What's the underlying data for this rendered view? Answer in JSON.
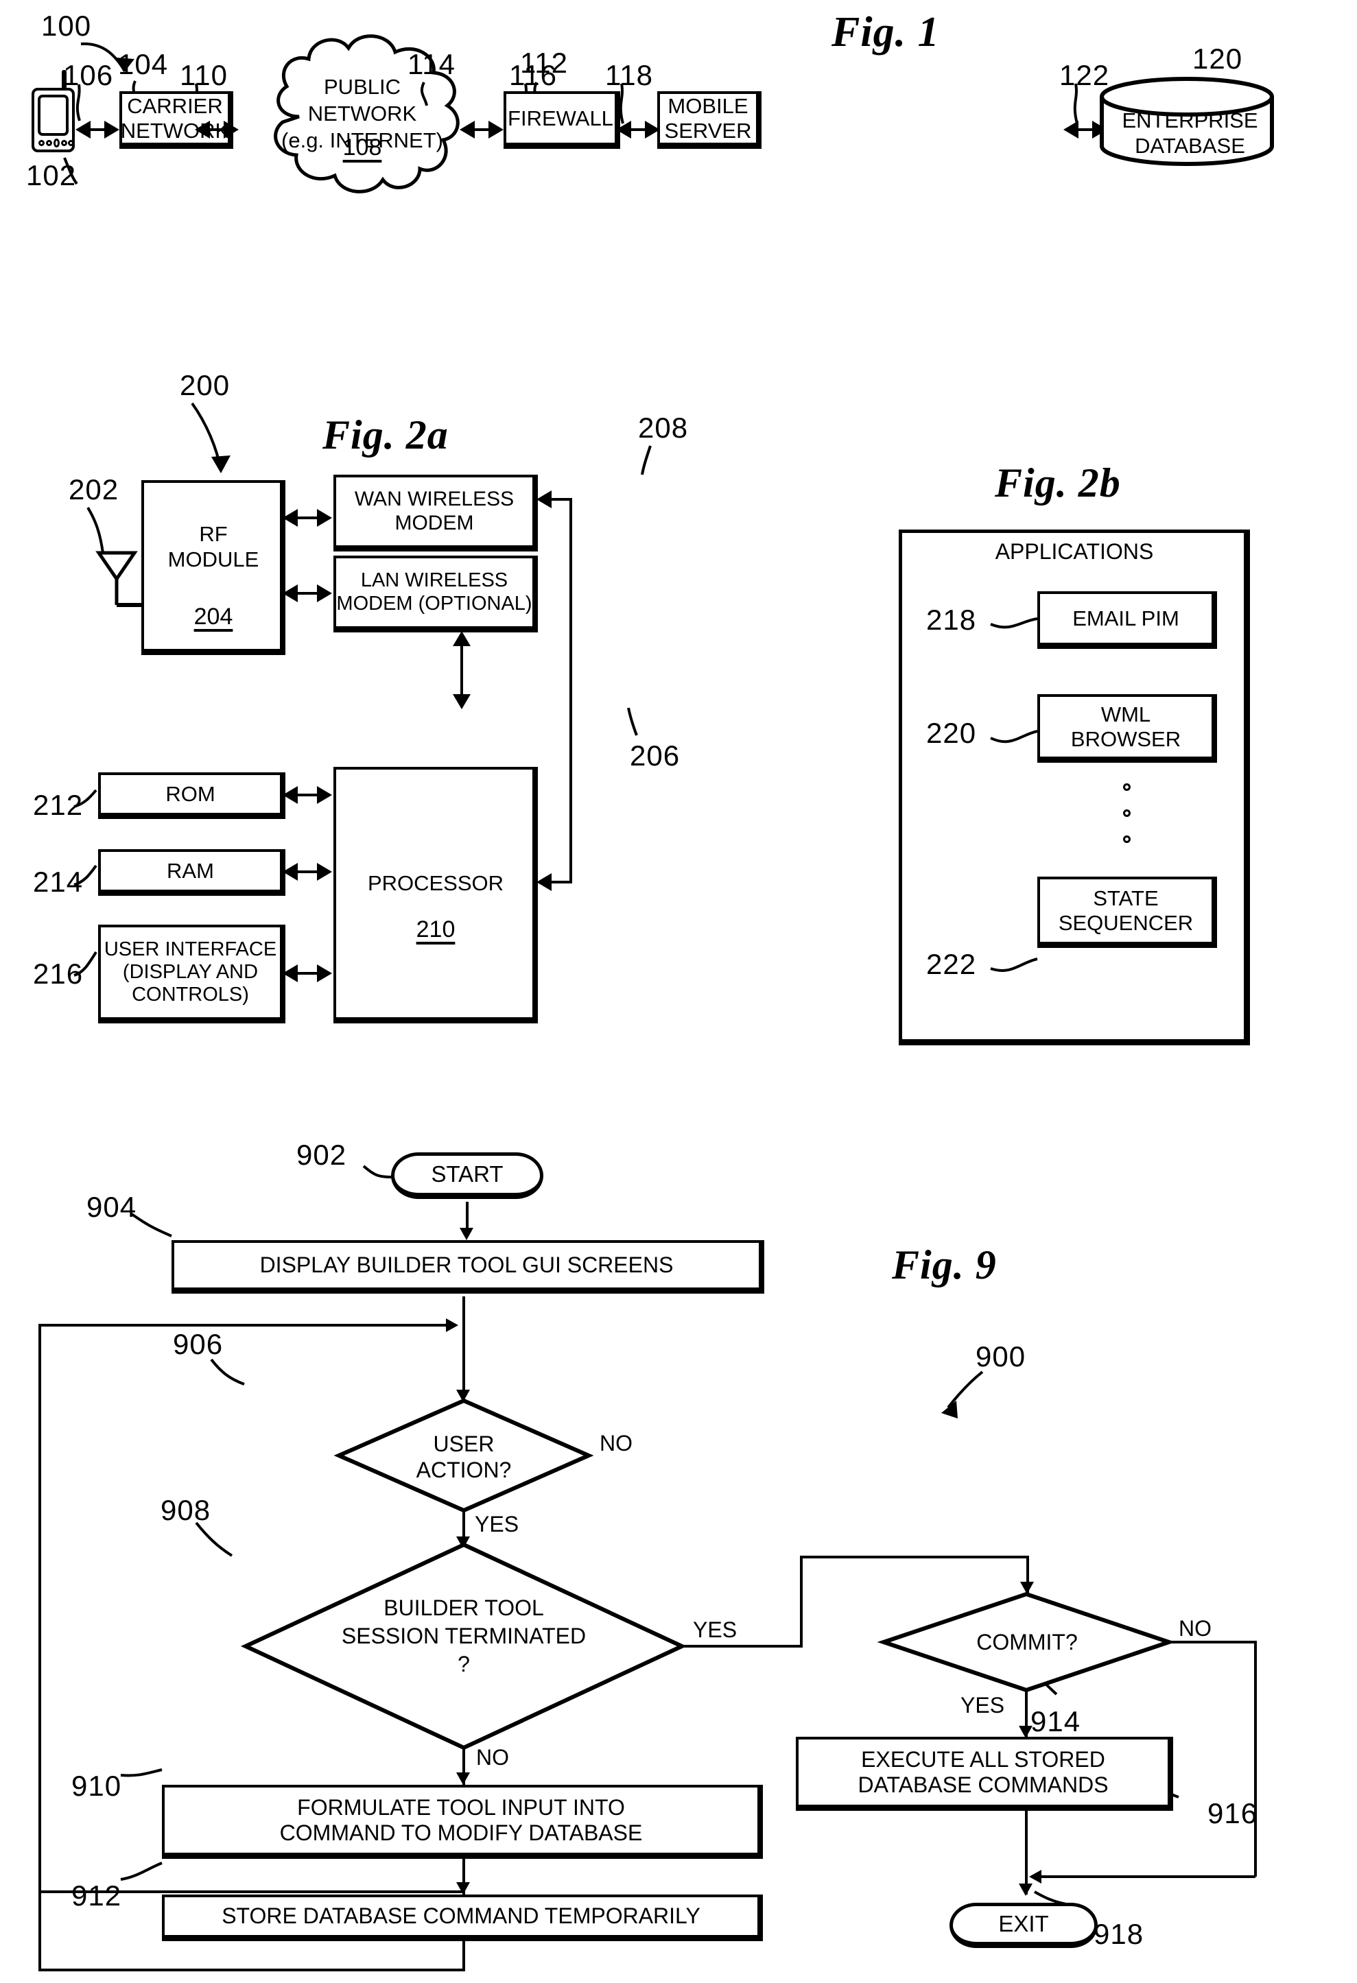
{
  "figures": [
    {
      "id": "fig1",
      "title": "Fig. 1",
      "system_ref": "100",
      "nodes": [
        {
          "ref": "102",
          "label": "mobile device"
        },
        {
          "ref": "104",
          "label": "CARRIER\nNETWORK"
        },
        {
          "ref": "108",
          "label": "PUBLIC\nNETWORK\n(e.g. INTERNET)"
        },
        {
          "ref": "114",
          "label": "FIREWALL"
        },
        {
          "ref": "112",
          "label": "MOBILE\nSERVER"
        },
        {
          "ref": "120",
          "label": "ENTERPRISE\nDATABASE"
        }
      ],
      "links": [
        "106",
        "110",
        "116",
        "118",
        "122"
      ]
    },
    {
      "id": "fig2a",
      "title": "Fig. 2a",
      "system_ref": "200",
      "nodes": [
        {
          "ref": "202",
          "label": "antenna"
        },
        {
          "ref": "204",
          "label": "RF\nMODULE"
        },
        {
          "ref": "208",
          "label": "WAN WIRELESS\nMODEM"
        },
        {
          "ref": "206",
          "label": "LAN WIRELESS\nMODEM (OPTIONAL)"
        },
        {
          "ref": "212",
          "label": "ROM"
        },
        {
          "ref": "214",
          "label": "RAM"
        },
        {
          "ref": "216",
          "label": "USER INTERFACE\n(DISPLAY AND\nCONTROLS)"
        },
        {
          "ref": "210",
          "label": "PROCESSOR"
        }
      ]
    },
    {
      "id": "fig2b",
      "title": "Fig. 2b",
      "container_label": "APPLICATIONS",
      "nodes": [
        {
          "ref": "218",
          "label": "EMAIL PIM"
        },
        {
          "ref": "220",
          "label": "WML\nBROWSER"
        },
        {
          "ref": "222",
          "label": "STATE\nSEQUENCER"
        }
      ],
      "ellipsis": "○ ○ ○"
    },
    {
      "id": "fig9",
      "title": "Fig. 9",
      "system_ref": "900",
      "nodes": [
        {
          "ref": "902",
          "label": "START",
          "shape": "terminator"
        },
        {
          "ref": "904",
          "label": "DISPLAY BUILDER TOOL GUI SCREENS",
          "shape": "process"
        },
        {
          "ref": "906",
          "label": "USER\nACTION?",
          "shape": "decision"
        },
        {
          "ref": "908",
          "label": "BUILDER TOOL\nSESSION TERMINATED\n?",
          "shape": "decision"
        },
        {
          "ref": "910",
          "label": "FORMULATE TOOL INPUT INTO\nCOMMAND TO MODIFY DATABASE",
          "shape": "process"
        },
        {
          "ref": "912",
          "label": "STORE DATABASE COMMAND TEMPORARILY",
          "shape": "process"
        },
        {
          "ref": "914",
          "label": "COMMIT?",
          "shape": "decision"
        },
        {
          "ref": "916",
          "label": "EXECUTE ALL STORED\nDATABASE COMMANDS",
          "shape": "process"
        },
        {
          "ref": "918",
          "label": "EXIT",
          "shape": "terminator"
        }
      ],
      "branch_labels": {
        "user_action_no": "NO",
        "user_action_yes": "YES",
        "session_yes": "YES",
        "session_no": "NO",
        "commit_no": "NO",
        "commit_yes": "YES"
      }
    }
  ],
  "fig1": {
    "title": "Fig. 1",
    "ref_system": "100",
    "ref_device": "102",
    "ref_link_device_carrier": "106",
    "ref_carrier": "104",
    "ref_link_carrier_net": "110",
    "ref_cloud": "108",
    "ref_link_net_firewall": "116",
    "ref_firewall": "114",
    "ref_link_firewall_server": "118",
    "ref_server": "112",
    "ref_link_server_db": "122",
    "ref_db": "120",
    "carrier_line1": "CARRIER",
    "carrier_line2": "NETWORK",
    "cloud_line1": "PUBLIC",
    "cloud_line2": "NETWORK",
    "cloud_line3": "(e.g. INTERNET)",
    "firewall_label": "FIREWALL",
    "server_line1": "MOBILE",
    "server_line2": "SERVER",
    "db_line1": "ENTERPRISE",
    "db_line2": "DATABASE"
  },
  "fig2a": {
    "title": "Fig. 2a",
    "ref_system": "200",
    "ref_antenna": "202",
    "ref_rf": "204",
    "ref_wan": "208",
    "ref_lan": "206",
    "ref_rom": "212",
    "ref_ram": "214",
    "ref_ui": "216",
    "ref_proc": "210",
    "rf_line1": "RF",
    "rf_line2": "MODULE",
    "wan_line1": "WAN WIRELESS",
    "wan_line2": "MODEM",
    "lan_line1": "LAN WIRELESS",
    "lan_line2": "MODEM (OPTIONAL)",
    "rom_label": "ROM",
    "ram_label": "RAM",
    "ui_line1": "USER INTERFACE",
    "ui_line2": "(DISPLAY AND",
    "ui_line3": "CONTROLS)",
    "proc_label": "PROCESSOR"
  },
  "fig2b": {
    "title": "Fig. 2b",
    "applications_label": "APPLICATIONS",
    "ref_email": "218",
    "ref_wml": "220",
    "ref_state": "222",
    "email_label": "EMAIL PIM",
    "wml_line1": "WML",
    "wml_line2": "BROWSER",
    "state_line1": "STATE",
    "state_line2": "SEQUENCER"
  },
  "fig9": {
    "title": "Fig. 9",
    "ref_system": "900",
    "ref_start": "902",
    "ref_display": "904",
    "ref_useraction": "906",
    "ref_session": "908",
    "ref_formulate": "910",
    "ref_store": "912",
    "ref_commit": "914",
    "ref_execute": "916",
    "ref_exit": "918",
    "start_label": "START",
    "display_label": "DISPLAY BUILDER TOOL GUI SCREENS",
    "useraction_line1": "USER",
    "useraction_line2": "ACTION?",
    "session_line1": "BUILDER TOOL",
    "session_line2": "SESSION TERMINATED",
    "session_line3": "?",
    "formulate_line1": "FORMULATE TOOL INPUT INTO",
    "formulate_line2": "COMMAND TO MODIFY DATABASE",
    "store_label": "STORE DATABASE COMMAND TEMPORARILY",
    "commit_label": "COMMIT?",
    "execute_line1": "EXECUTE ALL STORED",
    "execute_line2": "DATABASE COMMANDS",
    "exit_label": "EXIT",
    "lbl_no_1": "NO",
    "lbl_yes_1": "YES",
    "lbl_yes_2": "YES",
    "lbl_no_2": "NO",
    "lbl_no_3": "NO",
    "lbl_yes_3": "YES"
  }
}
